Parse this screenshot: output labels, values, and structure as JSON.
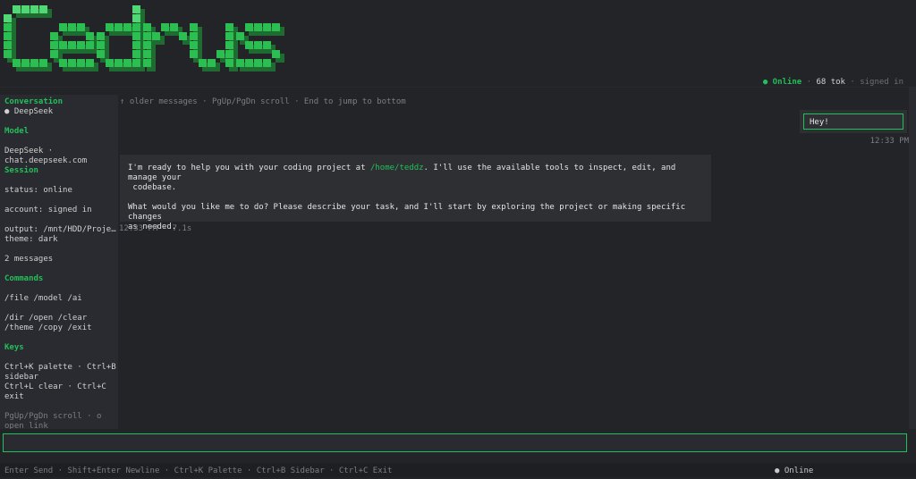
{
  "app": {
    "logo_text": "Cedrus"
  },
  "statusbar": {
    "online_dot": "●",
    "online_label": "Online",
    "sep1": " · ",
    "tokens": "68 tok",
    "sep2": " · ",
    "account": "signed in"
  },
  "sidebar": {
    "conversation_heading": "Conversation",
    "conversation_item": "● DeepSeek",
    "model_heading": "Model",
    "model_line1": "DeepSeek ·",
    "model_line2": "chat.deepseek.com",
    "session_heading": "Session",
    "status": "status: online",
    "account": "account: signed in",
    "output": "output: /mnt/HDD/Proje…",
    "theme": "theme: dark",
    "messages": "2 messages",
    "commands_heading": "Commands",
    "commands_line1": "/file /model /ai",
    "commands_line2": "/dir /open /clear",
    "commands_line3": "/theme /copy /exit",
    "keys_heading": "Keys",
    "keys_line1": "Ctrl+K palette · Ctrl+B",
    "keys_line2": "sidebar",
    "keys_line3": "Ctrl+L clear · Ctrl+C",
    "keys_line4": "exit",
    "keys_hint1": "PgUp/PgDn scroll · o",
    "keys_hint2": "open link"
  },
  "chat": {
    "scroll_hint": "↑ older messages · PgUp/PgDn scroll · End to jump to bottom",
    "user_message": "Hey!",
    "user_time": "12:33 PM",
    "ai_p1_before": "I'm ready to help you with your coding project at ",
    "ai_p1_path": "/home/teddz",
    "ai_p1_after": ". I'll use the available tools to inspect, edit, and manage your",
    "ai_p1_line2": " codebase.",
    "ai_p2_line1": "What would you like me to do? Please describe your task, and I'll start by exploring the project or making specific changes",
    "ai_p2_line2": "as needed.",
    "ai_meta": "12:33 PM · 7.1s"
  },
  "input": {
    "value": "",
    "placeholder": ""
  },
  "footer": {
    "keys": "Enter Send · Shift+Enter Newline · Ctrl+K Palette · Ctrl+B Sidebar · Ctrl+C Exit",
    "status": "● Online"
  },
  "colors": {
    "accent": "#22c05a",
    "background": "#232428",
    "panel": "#2a2b30",
    "bubble": "#2e2f33"
  }
}
